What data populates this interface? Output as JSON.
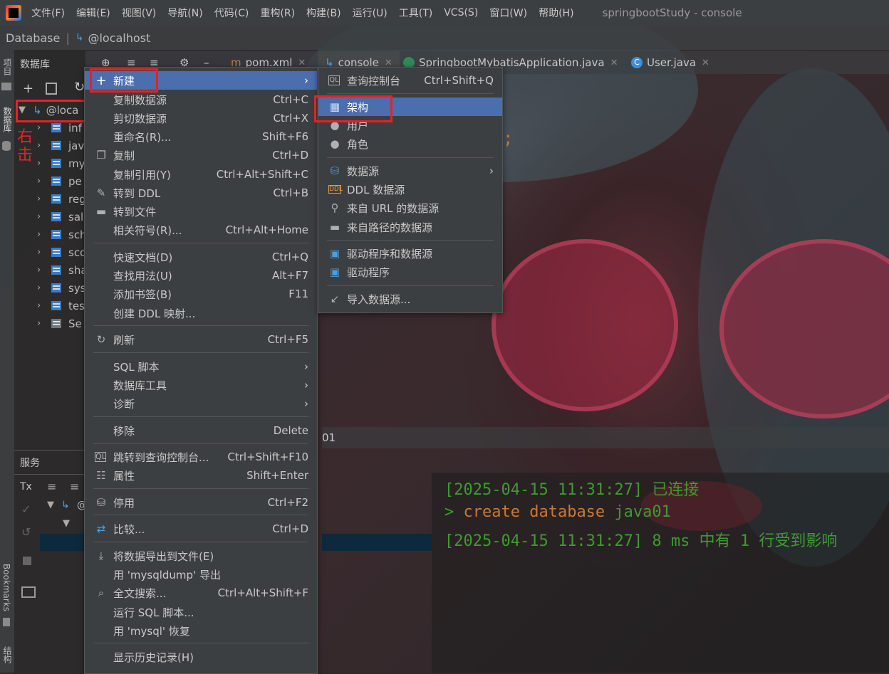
{
  "menubar": {
    "items": [
      "文件(F)",
      "编辑(E)",
      "视图(V)",
      "导航(N)",
      "代码(C)",
      "重构(R)",
      "构建(B)",
      "运行(U)",
      "工具(T)",
      "VCS(S)",
      "窗口(W)",
      "帮助(H)"
    ],
    "window_title": "springbootStudy - console"
  },
  "breadcrumb": {
    "root": "Database",
    "host": "@localhost"
  },
  "left_strip": {
    "project": "项目",
    "database": "数据库",
    "bookmarks": "Bookmarks",
    "structure": "结构"
  },
  "db_panel": {
    "title": "数据库",
    "root_node": "@loca",
    "annotation": "右击",
    "tree_items": [
      "inf",
      "jav",
      "my",
      "pe",
      "reg",
      "sal",
      "sch",
      "sco",
      "sha",
      "sys",
      "tes",
      "Se"
    ]
  },
  "tabs": [
    {
      "label": "pom.xml"
    },
    {
      "label": "console"
    },
    {
      "label": "SpringbootMybatisApplication.java"
    },
    {
      "label": "User.java"
    }
  ],
  "services": {
    "title": "服务",
    "tx": "Tx",
    "node": "@",
    "row_fragment": "01"
  },
  "context_menu": [
    {
      "label": "新建",
      "shortcut": "",
      "icon": "plus-icon",
      "submenu": true,
      "selected": true
    },
    {
      "label": "复制数据源",
      "shortcut": "Ctrl+C"
    },
    {
      "label": "剪切数据源",
      "shortcut": "Ctrl+X"
    },
    {
      "label": "重命名(R)...",
      "shortcut": "Shift+F6"
    },
    {
      "label": "复制",
      "shortcut": "Ctrl+D",
      "icon": "copy-icon"
    },
    {
      "label": "复制引用(Y)",
      "shortcut": "Ctrl+Alt+Shift+C"
    },
    {
      "label": "转到 DDL",
      "shortcut": "Ctrl+B",
      "icon": "pencil-icon"
    },
    {
      "label": "转到文件",
      "shortcut": "",
      "icon": "folder-icon"
    },
    {
      "label": "相关符号(R)...",
      "shortcut": "Ctrl+Alt+Home"
    },
    {
      "label": "快速文档(D)",
      "shortcut": "Ctrl+Q"
    },
    {
      "label": "查找用法(U)",
      "shortcut": "Alt+F7"
    },
    {
      "label": "添加书签(B)",
      "shortcut": "F11"
    },
    {
      "label": "创建 DDL 映射...",
      "shortcut": ""
    },
    {
      "label": "刷新",
      "shortcut": "Ctrl+F5",
      "icon": "refresh-icon"
    },
    {
      "label": "SQL 脚本",
      "shortcut": "",
      "submenu": true
    },
    {
      "label": "数据库工具",
      "shortcut": "",
      "submenu": true
    },
    {
      "label": "诊断",
      "shortcut": "",
      "submenu": true
    },
    {
      "label": "移除",
      "shortcut": "Delete"
    },
    {
      "label": "跳转到查询控制台...",
      "shortcut": "Ctrl+Shift+F10",
      "icon": "console-icon"
    },
    {
      "label": "属性",
      "shortcut": "Shift+Enter",
      "icon": "properties-icon"
    },
    {
      "label": "停用",
      "shortcut": "Ctrl+F2",
      "icon": "database-off-icon"
    },
    {
      "label": "比较...",
      "shortcut": "Ctrl+D",
      "icon": "compare-icon"
    },
    {
      "label": "将数据导出到文件(E)",
      "shortcut": "",
      "icon": "export-icon"
    },
    {
      "label": "用 'mysqldump' 导出",
      "shortcut": ""
    },
    {
      "label": "全文搜索...",
      "shortcut": "Ctrl+Alt+Shift+F",
      "icon": "search-icon"
    },
    {
      "label": "运行 SQL 脚本...",
      "shortcut": ""
    },
    {
      "label": "用 'mysql' 恢复",
      "shortcut": ""
    },
    {
      "label": "显示历史记录(H)",
      "shortcut": ""
    }
  ],
  "submenu": [
    {
      "label": "查询控制台",
      "shortcut": "Ctrl+Shift+Q",
      "icon": "console-icon"
    },
    {
      "label": "架构",
      "shortcut": "",
      "icon": "schema-icon",
      "selected": true
    },
    {
      "label": "用户",
      "shortcut": "",
      "icon": "user-icon"
    },
    {
      "label": "角色",
      "shortcut": "",
      "icon": "role-icon"
    },
    {
      "label": "数据源",
      "shortcut": "",
      "icon": "datasource-icon",
      "submenu": true
    },
    {
      "label": "DDL 数据源",
      "shortcut": "",
      "icon": "ddl-icon"
    },
    {
      "label": "来自 URL 的数据源",
      "shortcut": "",
      "icon": "url-icon"
    },
    {
      "label": "来自路径的数据源",
      "shortcut": "",
      "icon": "folder-icon"
    },
    {
      "label": "驱动程序和数据源",
      "shortcut": "",
      "icon": "driver-icon"
    },
    {
      "label": "驱动程序",
      "shortcut": "",
      "icon": "driver-icon"
    },
    {
      "label": "导入数据源...",
      "shortcut": "",
      "icon": "import-icon"
    }
  ],
  "editor": {
    "semicolon": ";"
  },
  "console": {
    "line1": "[2025-04-15 11:31:27] 已连接",
    "line2_prompt": ">",
    "line2_cmd": "create database",
    "line2_arg": "java01",
    "line3": "[2025-04-15 11:31:27] 8 ms 中有 1 行受到影响"
  },
  "colors": {
    "accent": "#4b6eaf",
    "highlight_box": "#e8202a",
    "console_green": "#3e9b2f",
    "console_keyword": "#cc7832"
  }
}
